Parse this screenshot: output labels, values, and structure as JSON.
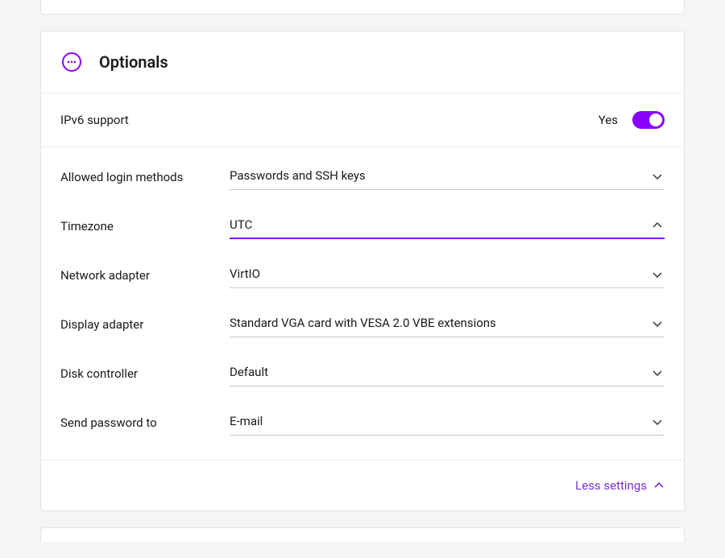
{
  "header": {
    "title": "Optionals"
  },
  "ipv6": {
    "label": "IPv6 support",
    "state_label": "Yes",
    "enabled": true
  },
  "fields": [
    {
      "label": "Allowed login methods",
      "value": "Passwords and SSH keys",
      "active": false
    },
    {
      "label": "Timezone",
      "value": "UTC",
      "active": true
    },
    {
      "label": "Network adapter",
      "value": "VirtIO",
      "active": false
    },
    {
      "label": "Display adapter",
      "value": "Standard VGA card with VESA 2.0 VBE extensions",
      "active": false
    },
    {
      "label": "Disk controller",
      "value": "Default",
      "active": false
    },
    {
      "label": "Send password to",
      "value": "E-mail",
      "active": false
    }
  ],
  "footer": {
    "less_settings": "Less settings"
  }
}
